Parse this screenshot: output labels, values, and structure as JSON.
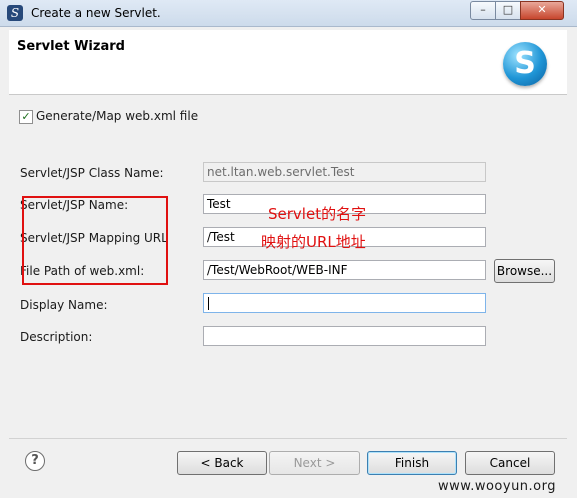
{
  "window": {
    "title": "Create a new Servlet.",
    "min_glyph": "–",
    "max_glyph": "□",
    "close_glyph": "✕",
    "app_icon_glyph": "S"
  },
  "header": {
    "title": "Servlet Wizard",
    "logo_glyph": "S"
  },
  "generate_checkbox": {
    "label": "Generate/Map web.xml file",
    "checked": true,
    "check_glyph": "✓"
  },
  "form": {
    "class_name": {
      "label": "Servlet/JSP Class Name:",
      "value": "net.ltan.web.servlet.Test"
    },
    "jsp_name": {
      "label": "Servlet/JSP Name:",
      "value": "Test"
    },
    "mapping_url": {
      "label": "Servlet/JSP Mapping URL",
      "value": "/Test"
    },
    "file_path": {
      "label": "File Path of web.xml:",
      "value": "/Test/WebRoot/WEB-INF",
      "browse_label": "Browse..."
    },
    "display_name": {
      "label": "Display Name:",
      "value": ""
    },
    "description": {
      "label": "Description:",
      "value": ""
    }
  },
  "annotations": {
    "servlet_name": "Servlet的名字",
    "url_mapping": "映射的URL地址",
    "color": "#e01010"
  },
  "buttons": {
    "help_glyph": "?",
    "back": "< Back",
    "next": "Next >",
    "finish": "Finish",
    "cancel": "Cancel"
  },
  "watermark": "www.wooyun.org"
}
